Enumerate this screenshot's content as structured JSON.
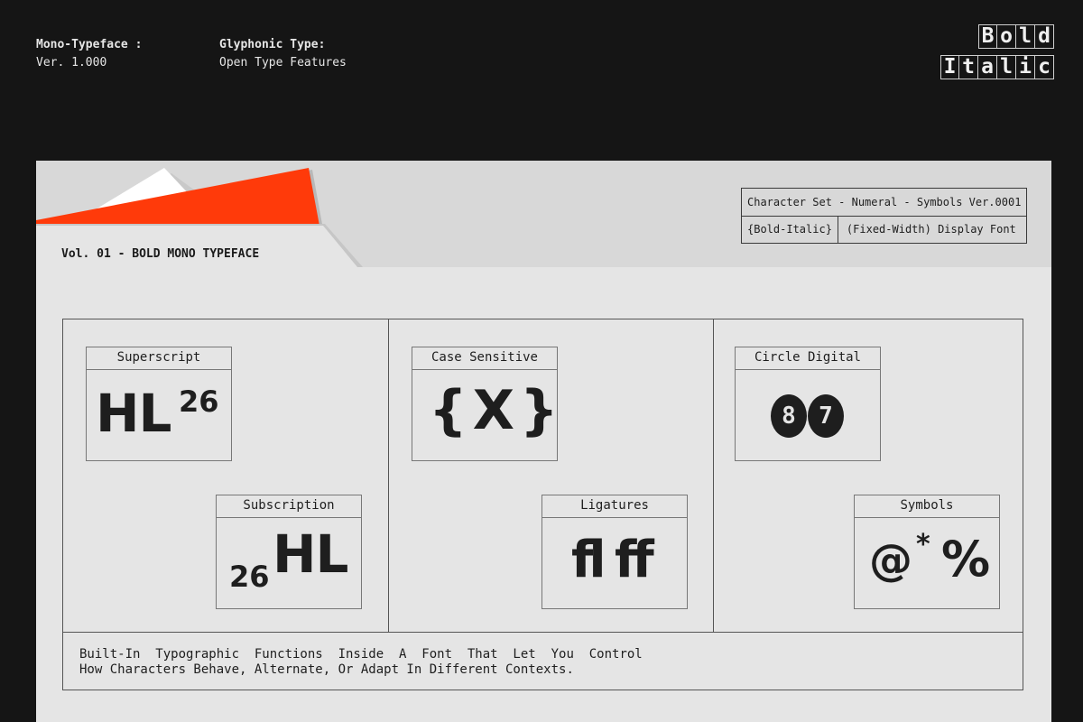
{
  "header": {
    "left_title": "Mono-Typeface :",
    "left_sub": "Ver. 1.000",
    "mid_title": "Glyphonic Type:",
    "mid_sub": "Open Type Features"
  },
  "logo": {
    "row1": [
      "B",
      "o",
      "l",
      "d"
    ],
    "row2": [
      "I",
      "t",
      "a",
      "l",
      "i",
      "c"
    ]
  },
  "card": {
    "volume_title": "Vol. 01 - BOLD MONO TYPEFACE",
    "meta_line1": "Character Set - Numeral - Symbols Ver.0001",
    "meta_cell1": "{Bold-Italic}",
    "meta_cell2": "(Fixed-Width) Display Font"
  },
  "features": {
    "superscript": {
      "label": "Superscript",
      "base": "HL",
      "sup": "26"
    },
    "subscription": {
      "label": "Subscription",
      "sub": "26",
      "base": "HL"
    },
    "case_sensitive": {
      "label": "Case Sensitive",
      "glyph": "{X}"
    },
    "ligatures": {
      "label": "Ligatures",
      "glyph": "fl ff"
    },
    "circle_digital": {
      "label": "Circle Digital",
      "d1": "8",
      "d2": "7"
    },
    "symbols": {
      "label": "Symbols",
      "g1": "@",
      "g2": "*",
      "g3": "%"
    }
  },
  "description": {
    "line1": "Built-In  Typographic  Functions  Inside  A  Font  That  Let  You  Control",
    "line2": "How Characters Behave, Alternate, Or Adapt In Different Contexts."
  },
  "colors": {
    "accent": "#ff3a0a",
    "background": "#151515",
    "card": "#e5e5e5"
  }
}
